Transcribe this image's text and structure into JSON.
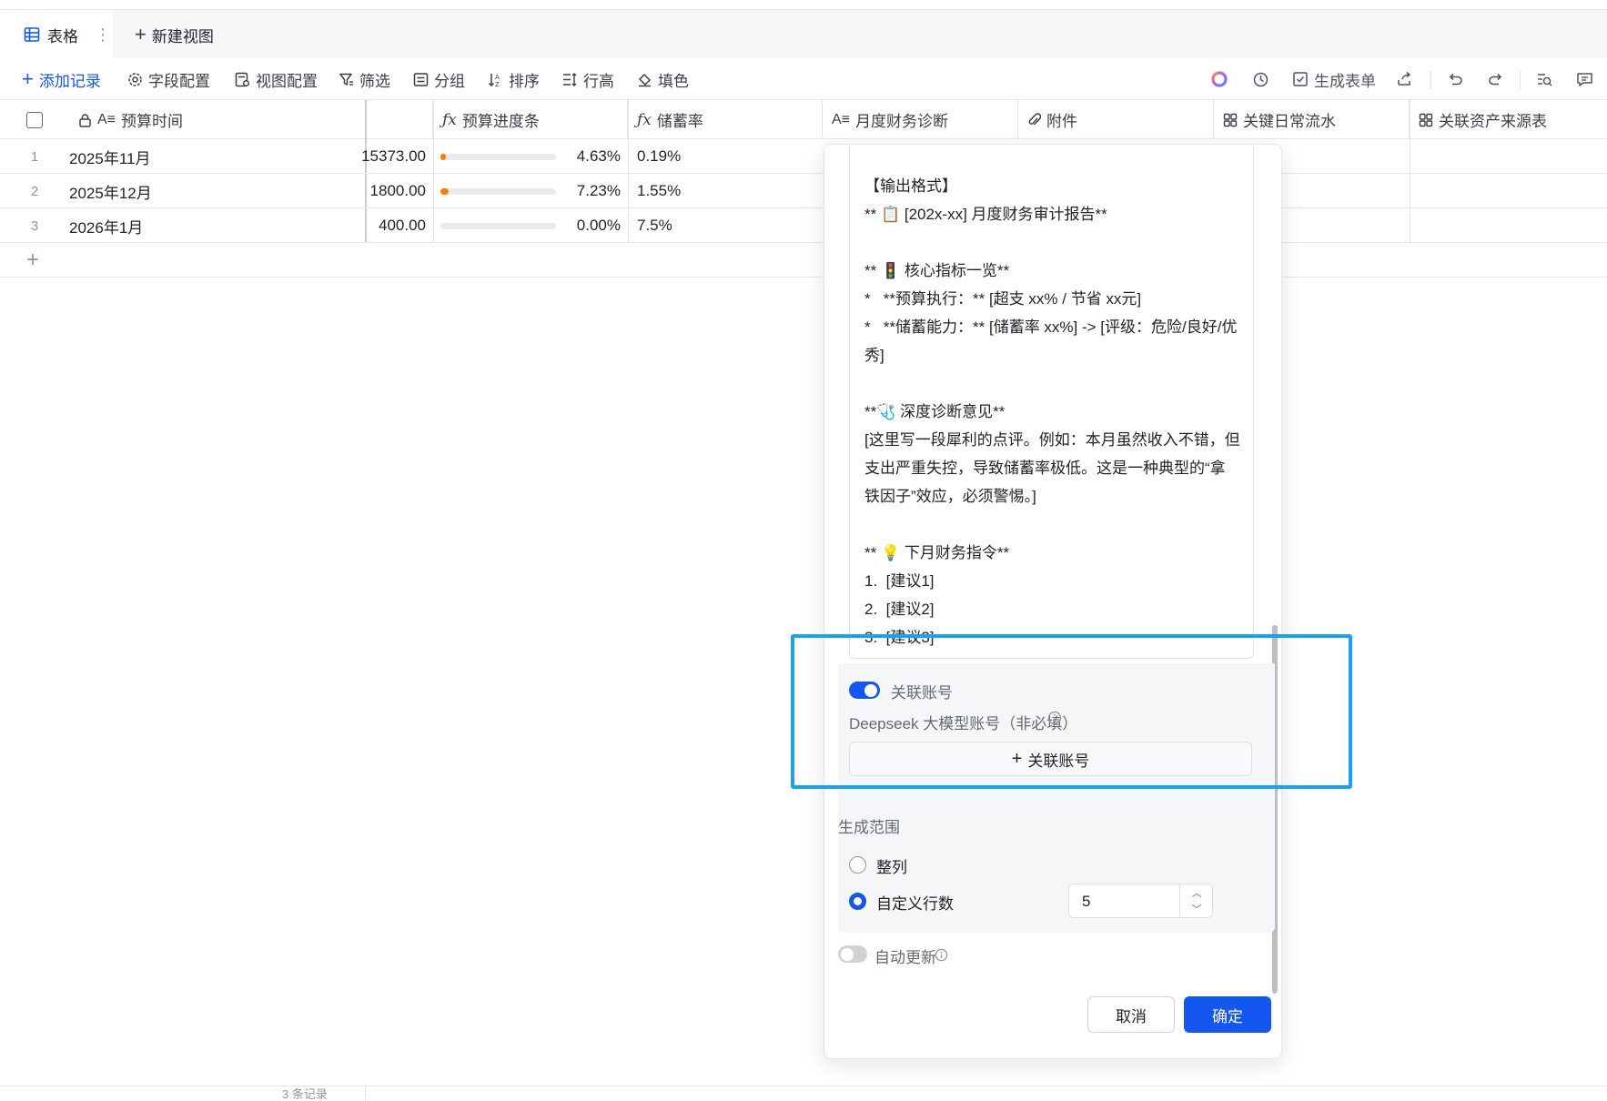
{
  "view_tabs": {
    "active": "表格",
    "new_view": "新建视图"
  },
  "toolbar": {
    "add_record": "添加记录",
    "field_config": "字段配置",
    "view_config": "视图配置",
    "filter": "筛选",
    "group": "分组",
    "sort": "排序",
    "row_height": "行高",
    "fill_color": "填色",
    "generate_form": "生成表单"
  },
  "columns": {
    "budget_time": "预算时间",
    "budget_progress": "预算进度条",
    "savings_rate": "储蓄率",
    "monthly_diagnosis": "月度财务诊断",
    "attachment": "附件",
    "daily_flow": "关键日常流水",
    "asset_source": "关联资产来源表"
  },
  "rows": [
    {
      "num": "1",
      "time": "2025年11月",
      "amount": "15373.00",
      "progress": 0.0463,
      "progress_text": "4.63%",
      "savings": "0.19%"
    },
    {
      "num": "2",
      "time": "2025年12月",
      "amount": "1800.00",
      "progress": 0.0723,
      "progress_text": "7.23%",
      "savings": "1.55%"
    },
    {
      "num": "3",
      "time": "2026年1月",
      "amount": "400.00",
      "progress": 0.0,
      "progress_text": "0.00%",
      "savings": "7.5%"
    }
  ],
  "footer": {
    "record_count": "3 条记录"
  },
  "dialog": {
    "prompt_lines": [
      "【输出格式】",
      "** 📋 [202x-xx] 月度财务审计报告**",
      "",
      "** 🚦 核心指标一览**",
      "*   **预算执行：** [超支 xx% / 节省 xx元]",
      "*   **储蓄能力：** [储蓄率 xx%] -> [评级：危险/良好/优秀]",
      "",
      "**🩺 深度诊断意见**",
      "[这里写一段犀利的点评。例如：本月虽然收入不错，但支出严重失控，导致储蓄率极低。这是一种典型的“拿铁因子”效应，必须警惕。]",
      "",
      "** 💡 下月财务指令**",
      "1.  [建议1]",
      "2.  [建议2]",
      "3.  [建议3]"
    ],
    "link_account_toggle": "关联账号",
    "account_label": "Deepseek 大模型账号（非必填）",
    "link_account_button": "关联账号",
    "range_title": "生成范围",
    "range_whole": "整列",
    "range_custom": "自定义行数",
    "custom_rows_value": "5",
    "auto_update": "自动更新",
    "cancel": "取消",
    "confirm": "确定"
  }
}
